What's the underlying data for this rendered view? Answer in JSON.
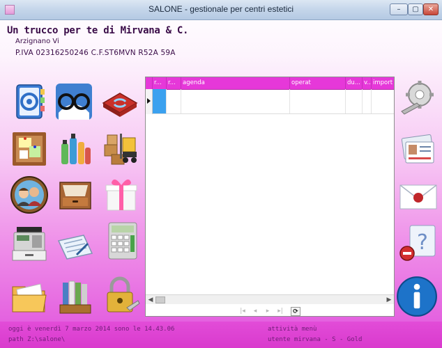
{
  "window": {
    "title": "SALONE - gestionale per centri estetici",
    "minimize_label": "–",
    "maximize_label": "▢",
    "close_label": "✕"
  },
  "company": {
    "name": "Un trucco per te di Mirvana & C.",
    "city": "Arzignano Vi",
    "vat": "P.IVA 02316250246 C.F.ST6MVN   R52A  59A"
  },
  "launcher_left": [
    {
      "id": "address-book",
      "icon": "address-book-icon"
    },
    {
      "id": "reading-glasses",
      "icon": "reading-glasses-icon"
    },
    {
      "id": "sync-arrows",
      "icon": "sync-arrows-icon"
    },
    {
      "id": "notice-board",
      "icon": "notice-board-icon"
    },
    {
      "id": "cosmetics",
      "icon": "cosmetics-icon"
    },
    {
      "id": "warehouse",
      "icon": "forklift-boxes-icon"
    },
    {
      "id": "clients",
      "icon": "clients-portrait-icon"
    },
    {
      "id": "archive-drawer",
      "icon": "drawer-icon"
    },
    {
      "id": "gift",
      "icon": "gift-box-icon"
    },
    {
      "id": "cash-register",
      "icon": "cash-register-icon"
    },
    {
      "id": "documents",
      "icon": "documents-icon"
    },
    {
      "id": "calculator",
      "icon": "calculator-icon"
    },
    {
      "id": "folders",
      "icon": "folders-icon"
    },
    {
      "id": "binders",
      "icon": "binders-icon"
    },
    {
      "id": "security",
      "icon": "padlock-key-icon"
    }
  ],
  "launcher_right": [
    {
      "id": "settings",
      "icon": "gear-wrench-icon"
    },
    {
      "id": "id-cards",
      "icon": "id-cards-icon"
    },
    {
      "id": "mail",
      "icon": "envelope-icon"
    },
    {
      "id": "help",
      "icon": "help-question-icon"
    },
    {
      "id": "info",
      "icon": "info-icon"
    }
  ],
  "grid": {
    "columns": [
      "r...",
      "r...",
      "agenda",
      "operat",
      "du...",
      "v...",
      "import"
    ],
    "rows": [
      [
        "",
        "",
        "",
        "",
        "",
        "",
        ""
      ]
    ]
  },
  "navigator": {
    "first": "|◂",
    "prev": "◂",
    "next": "▸",
    "last": "▸|",
    "refresh": "⟳"
  },
  "status": {
    "datetime": "oggi è venerdì 7 marzo 2014 sono le 14.43.06",
    "path": "path Z:\\salone\\",
    "activity": "attività menù",
    "client": "utente mirvana - S - Gold"
  },
  "colors": {
    "header_magenta": "#e638d9",
    "selected_cell": "#3ba1ef",
    "status_bar": "#d93acd"
  }
}
